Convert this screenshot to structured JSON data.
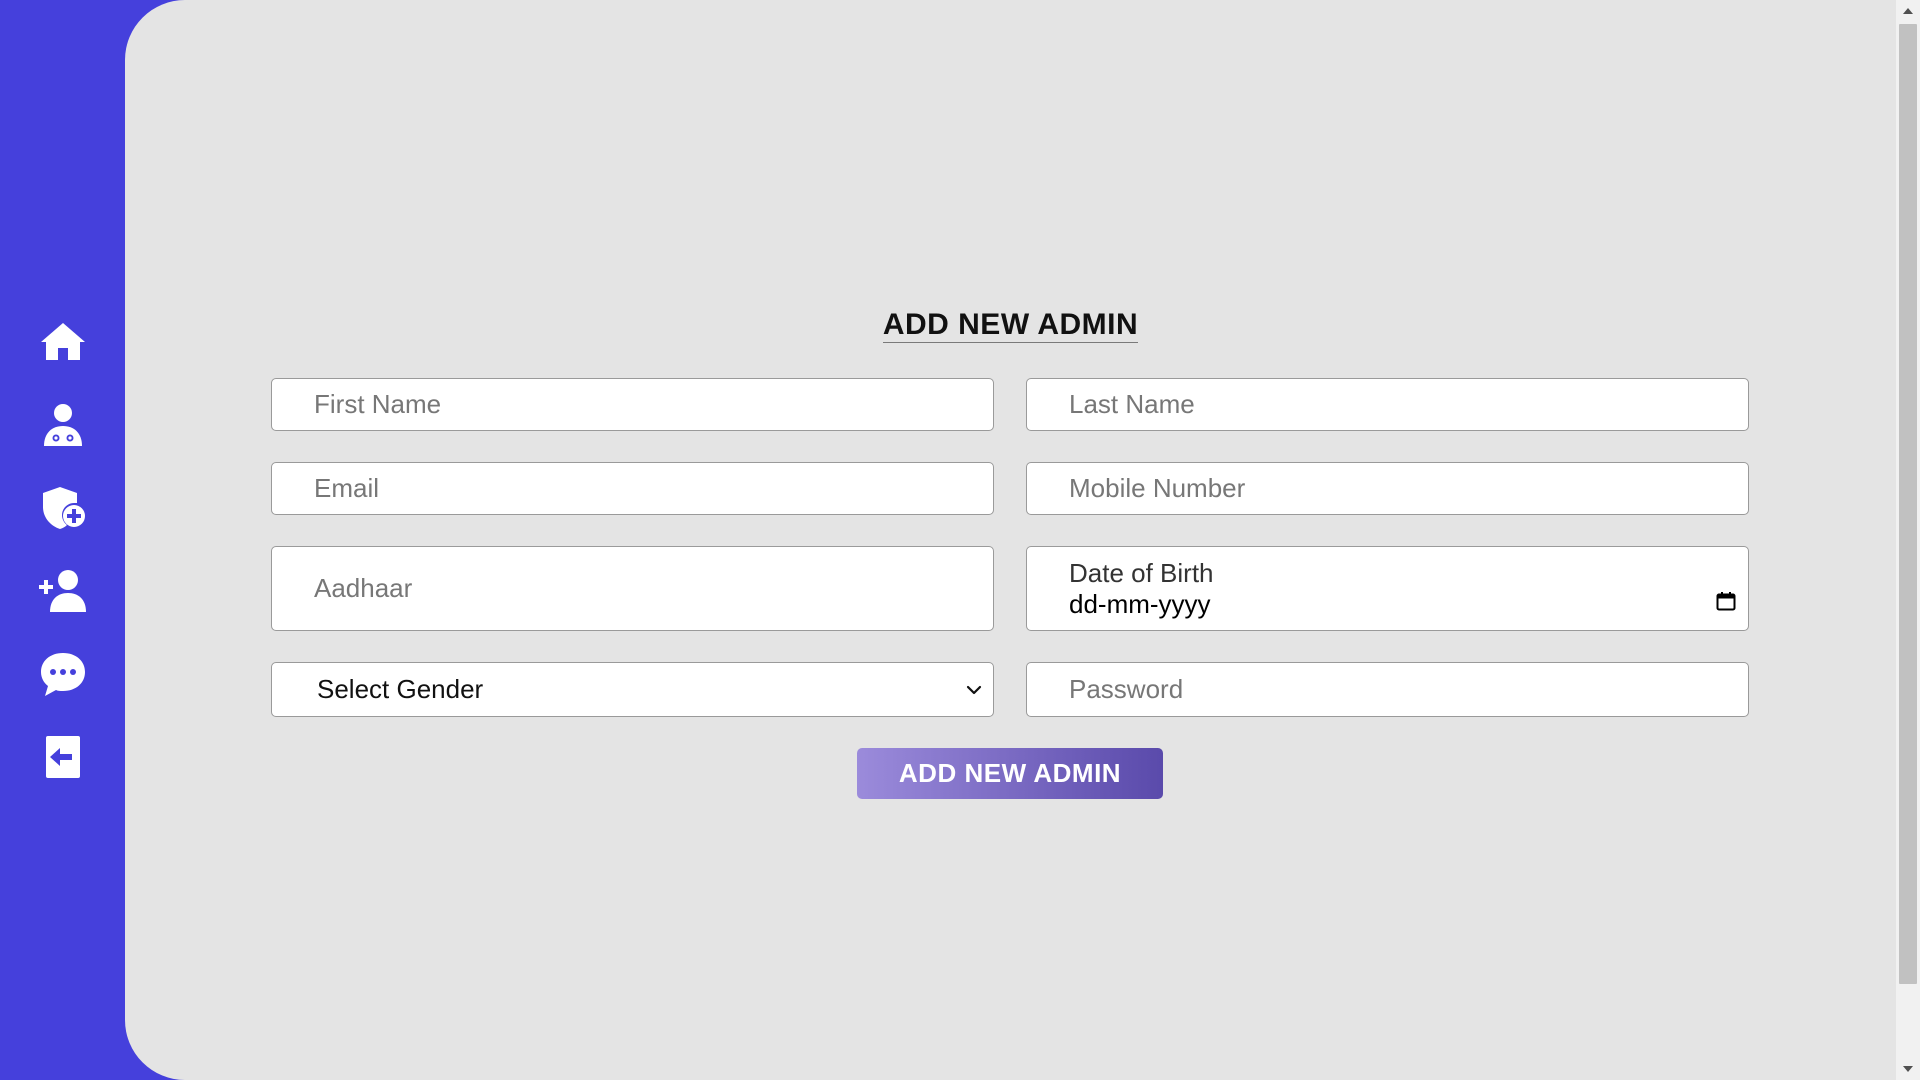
{
  "sidebar": {
    "items": [
      {
        "icon": "home-icon"
      },
      {
        "icon": "doctor-icon"
      },
      {
        "icon": "shield-plus-icon"
      },
      {
        "icon": "user-plus-icon"
      },
      {
        "icon": "chat-icon"
      },
      {
        "icon": "logout-icon"
      }
    ]
  },
  "form": {
    "title": "ADD NEW ADMIN",
    "first_name_placeholder": "First Name",
    "last_name_placeholder": "Last Name",
    "email_placeholder": "Email",
    "mobile_placeholder": "Mobile Number",
    "aadhaar_placeholder": "Aadhaar",
    "dob_label": "Date of Birth",
    "dob_value": "dd-mm-yyyy",
    "gender_selected": "Select Gender",
    "password_placeholder": "Password",
    "submit_label": "ADD NEW ADMIN"
  },
  "colors": {
    "sidebar": "#4540dc",
    "main_bg": "#e4e4e4",
    "button_gradient_start": "#9b8bdb",
    "button_gradient_end": "#5a4aab"
  }
}
